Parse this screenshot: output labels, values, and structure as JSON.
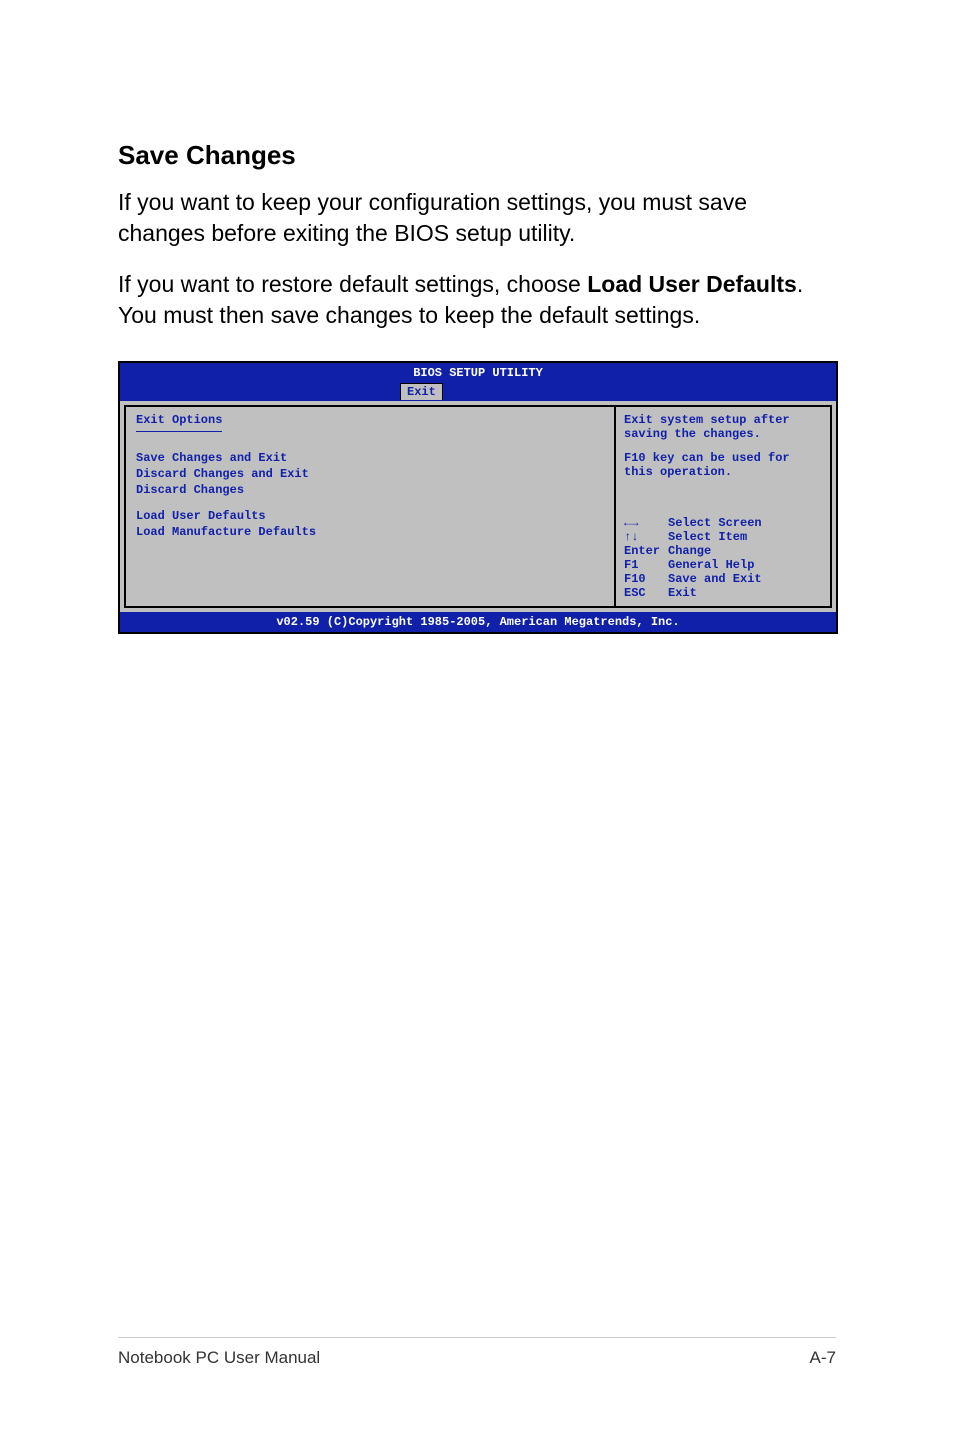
{
  "page": {
    "heading": "Save Changes",
    "paragraph1": "If you want to keep your configuration settings, you must save changes before exiting the BIOS setup utility.",
    "paragraph2_a": "If you want to restore default settings, choose ",
    "paragraph2_bold": "Load User Defaults",
    "paragraph2_b": ". You must then save changes to keep the default settings."
  },
  "bios": {
    "title": "BIOS SETUP UTILITY",
    "tab": "Exit",
    "left_heading": "Exit Options",
    "options": [
      "Save Changes and Exit",
      "Discard Changes and Exit",
      "Discard Changes"
    ],
    "options2": [
      "Load User Defaults",
      "Load Manufacture Defaults"
    ],
    "help_line1": "Exit system setup after saving the changes.",
    "help_line2": "F10 key can be used for this operation.",
    "keys": {
      "arrows_h": "←→",
      "arrows_h_label": "Select Screen",
      "arrows_v": "↑↓",
      "arrows_v_label": "Select Item",
      "enter": "Enter",
      "enter_label": "Change",
      "f1": "F1",
      "f1_label": "General Help",
      "f10": "F10",
      "f10_label": "Save and Exit",
      "esc": "ESC",
      "esc_label": "Exit"
    },
    "footer": "v02.59 (C)Copyright 1985-2005, American Megatrends, Inc."
  },
  "footer": {
    "left": "Notebook PC User Manual",
    "right": "A-7"
  }
}
